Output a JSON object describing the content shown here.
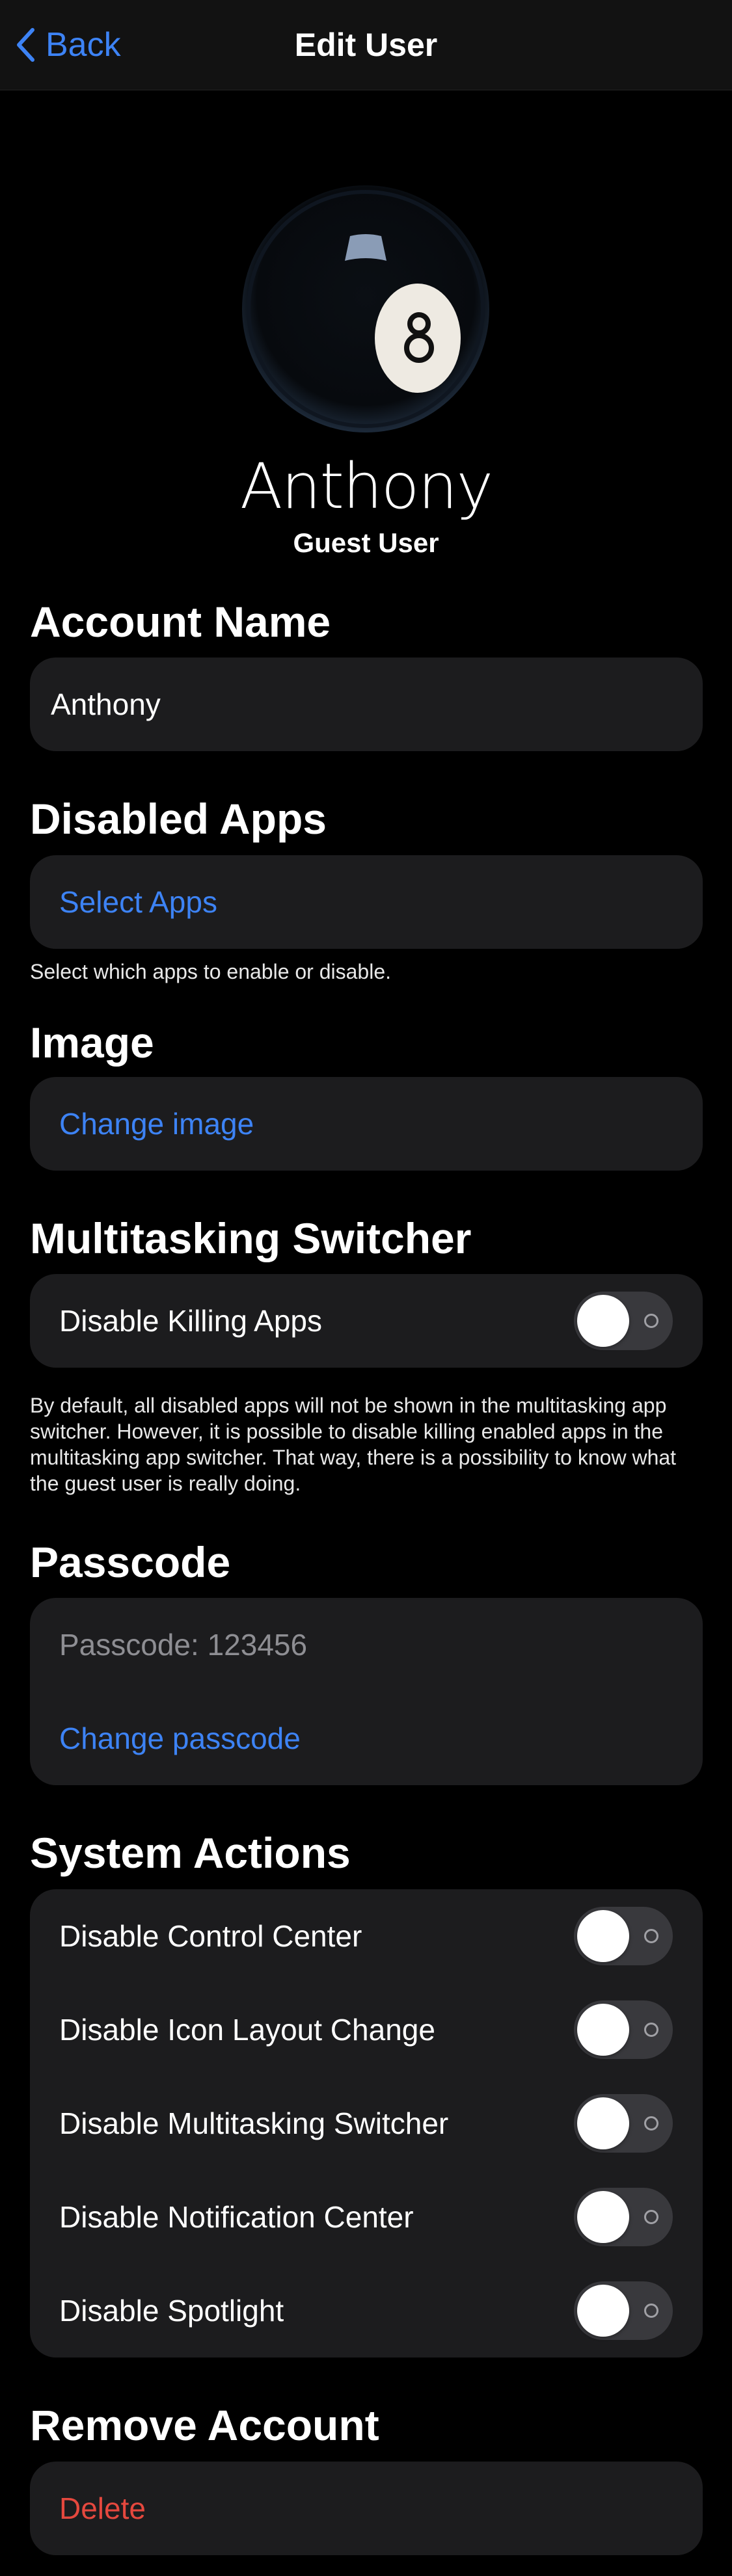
{
  "nav": {
    "back_label": "Back",
    "title": "Edit User"
  },
  "profile": {
    "name": "Anthony",
    "role": "Guest User",
    "avatar_icon": "eight-ball-icon"
  },
  "account_name": {
    "heading": "Account Name",
    "value": "Anthony"
  },
  "disabled_apps": {
    "heading": "Disabled Apps",
    "action": "Select Apps",
    "footer": "Select which apps to enable or disable."
  },
  "image": {
    "heading": "Image",
    "action": "Change image"
  },
  "multitasking": {
    "heading": "Multitasking Switcher",
    "toggle_label": "Disable Killing Apps",
    "toggle_on": false,
    "footer": "By default, all disabled apps will not be shown in the multitasking app switcher. However, it is possible to disable killing enabled apps in the multitasking app switcher. That way, there is a possibility to know what the guest user is really doing."
  },
  "passcode": {
    "heading": "Passcode",
    "current": "Passcode: 123456",
    "action": "Change passcode"
  },
  "system_actions": {
    "heading": "System Actions",
    "items": [
      {
        "label": "Disable Control Center",
        "on": false
      },
      {
        "label": "Disable Icon Layout Change",
        "on": false
      },
      {
        "label": "Disable Multitasking Switcher",
        "on": false
      },
      {
        "label": "Disable Notification Center",
        "on": false
      },
      {
        "label": "Disable Spotlight",
        "on": false
      }
    ]
  },
  "remove_account": {
    "heading": "Remove Account",
    "action": "Delete"
  },
  "colors": {
    "accent": "#3d83f5",
    "destructive": "#e5483e",
    "cell": "#1c1c1e",
    "background": "#000000"
  }
}
